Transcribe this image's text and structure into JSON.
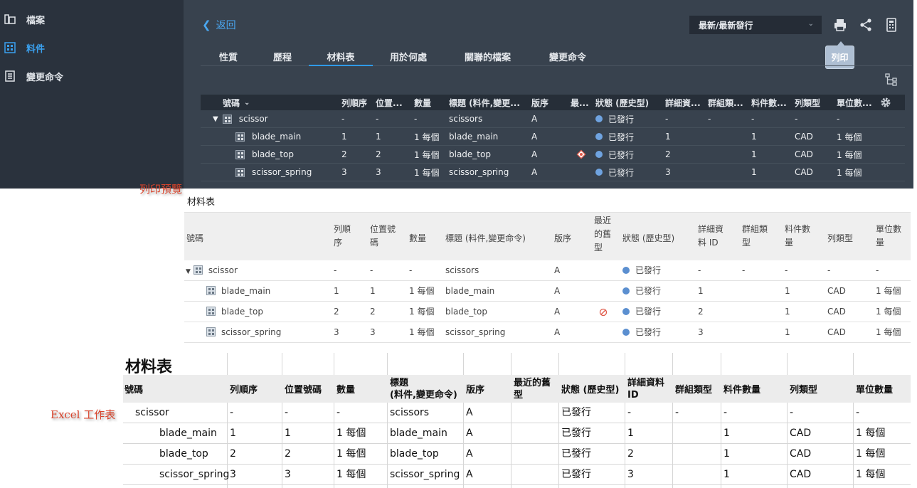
{
  "sidebar": {
    "items": [
      {
        "label": "檔案",
        "icon": "folder-icon",
        "active": false
      },
      {
        "label": "料件",
        "icon": "grid-icon",
        "active": true
      },
      {
        "label": "變更命令",
        "icon": "list-icon",
        "active": false
      }
    ]
  },
  "toolbar": {
    "back_label": "返回",
    "release_select": "最新/最新發行",
    "print_tooltip": "列印",
    "icons": [
      "print-icon",
      "share-icon",
      "calculator-icon"
    ]
  },
  "tabs": [
    "性質",
    "歷程",
    "材料表",
    "用於何處",
    "關聯的檔案",
    "變更命令"
  ],
  "active_tab": "材料表",
  "grid": {
    "columns": [
      "號碼",
      "列順序",
      "位置...",
      "數量",
      "標題 (料件,變更...",
      "版序",
      "最...",
      "狀態 (歷史型)",
      "詳細資...",
      "群組類...",
      "料件數...",
      "列類型",
      "單位數..."
    ],
    "rows": [
      {
        "cells": [
          "scissor",
          "-",
          "-",
          "-",
          "scissors",
          "A",
          "",
          "已發行",
          "-",
          "-",
          "-",
          "-",
          "-"
        ]
      },
      {
        "cells": [
          "blade_main",
          "1",
          "1",
          "1 每個",
          "blade_main",
          "A",
          "",
          "已發行",
          "1",
          "",
          "1",
          "CAD",
          "1 每個"
        ]
      },
      {
        "cells": [
          "blade_top",
          "2",
          "2",
          "1 每個",
          "blade_top",
          "A",
          "",
          "已發行",
          "2",
          "",
          "1",
          "CAD",
          "1 每個"
        ]
      },
      {
        "cells": [
          "scissor_spring",
          "3",
          "3",
          "1 每個",
          "scissor_spring",
          "A",
          "",
          "已發行",
          "3",
          "",
          "1",
          "CAD",
          "1 每個"
        ]
      }
    ]
  },
  "print_preview": {
    "label": "列印預覽",
    "title": "材料表",
    "columns": [
      "號碼",
      "列順\n序",
      "位置號\n碼",
      "數量",
      "標題 (料件,變更命令)",
      "版序",
      "最近\n的舊\n型",
      "狀態 (歷史型)",
      "詳細資\n料 ID",
      "群組類\n型",
      "料件數\n量",
      "列類型",
      "單位數\n量"
    ],
    "rows": [
      {
        "cells": [
          "scissor",
          "-",
          "-",
          "-",
          "scissors",
          "A",
          "",
          "已發行",
          "-",
          "-",
          "-",
          "-",
          "-"
        ]
      },
      {
        "cells": [
          "blade_main",
          "1",
          "1",
          "1 每個",
          "blade_main",
          "A",
          "",
          "已發行",
          "1",
          "",
          "1",
          "CAD",
          "1 每個"
        ]
      },
      {
        "cells": [
          "blade_top",
          "2",
          "2",
          "1 每個",
          "blade_top",
          "A",
          "",
          "已發行",
          "2",
          "",
          "1",
          "CAD",
          "1 每個"
        ]
      },
      {
        "cells": [
          "scissor_spring",
          "3",
          "3",
          "1 每個",
          "scissor_spring",
          "A",
          "",
          "已發行",
          "3",
          "",
          "1",
          "CAD",
          "1 每個"
        ]
      }
    ]
  },
  "excel": {
    "label": "Excel 工作表",
    "title": "材料表",
    "columns": [
      "號碼",
      "列順序",
      "位置號碼",
      "數量",
      "標題\n(料件,變更命令)",
      "版序",
      "最近的舊\n型",
      "狀態 (歷史型)",
      "詳細資料\nID",
      "群組類型",
      "料件數量",
      "列類型",
      "單位數量"
    ],
    "rows": [
      {
        "cells": [
          "scissor",
          "-",
          "-",
          "-",
          "scissors",
          "A",
          "",
          "已發行",
          "-",
          "-",
          "-",
          "-",
          "-"
        ]
      },
      {
        "cells": [
          "blade_main",
          "1",
          "1",
          "1 每個",
          "blade_main",
          "A",
          "",
          "已發行",
          "1",
          "",
          "1",
          "CAD",
          "1 每個"
        ]
      },
      {
        "cells": [
          "blade_top",
          "2",
          "2",
          "1 每個",
          "blade_top",
          "A",
          "",
          "已發行",
          "2",
          "",
          "1",
          "CAD",
          "1 每個"
        ]
      },
      {
        "cells": [
          "scissor_spring",
          "3",
          "3",
          "1 每個",
          "scissor_spring",
          "A",
          "",
          "已發行",
          "3",
          "",
          "1",
          "CAD",
          "1 每個"
        ]
      }
    ]
  },
  "colors": {
    "accent": "#3aa0ee",
    "status_dot": "#6fa3e0",
    "warning": "#e05a4a",
    "app_bg": "#38424e",
    "sidebar_bg": "#2a323d"
  }
}
